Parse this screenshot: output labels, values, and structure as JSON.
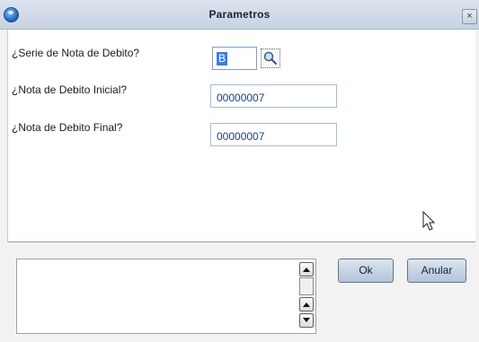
{
  "window": {
    "title": "Parametros",
    "close_glyph": "×"
  },
  "form": {
    "serie": {
      "label": "¿Serie de Nota de Debito?",
      "value": "B"
    },
    "inicial": {
      "label": "¿Nota de Debito Inicial?",
      "value": "00000007"
    },
    "final": {
      "label": "¿Nota de Debito Final?",
      "value": "00000007"
    }
  },
  "buttons": {
    "ok": "Ok",
    "anular": "Anular"
  },
  "icons": {
    "app": "app-globe-icon",
    "lookup": "magnifier-icon",
    "cursor": "mouse-pointer-icon"
  },
  "colors": {
    "accent": "#3d7de0",
    "field_text": "#1f3f7a"
  }
}
